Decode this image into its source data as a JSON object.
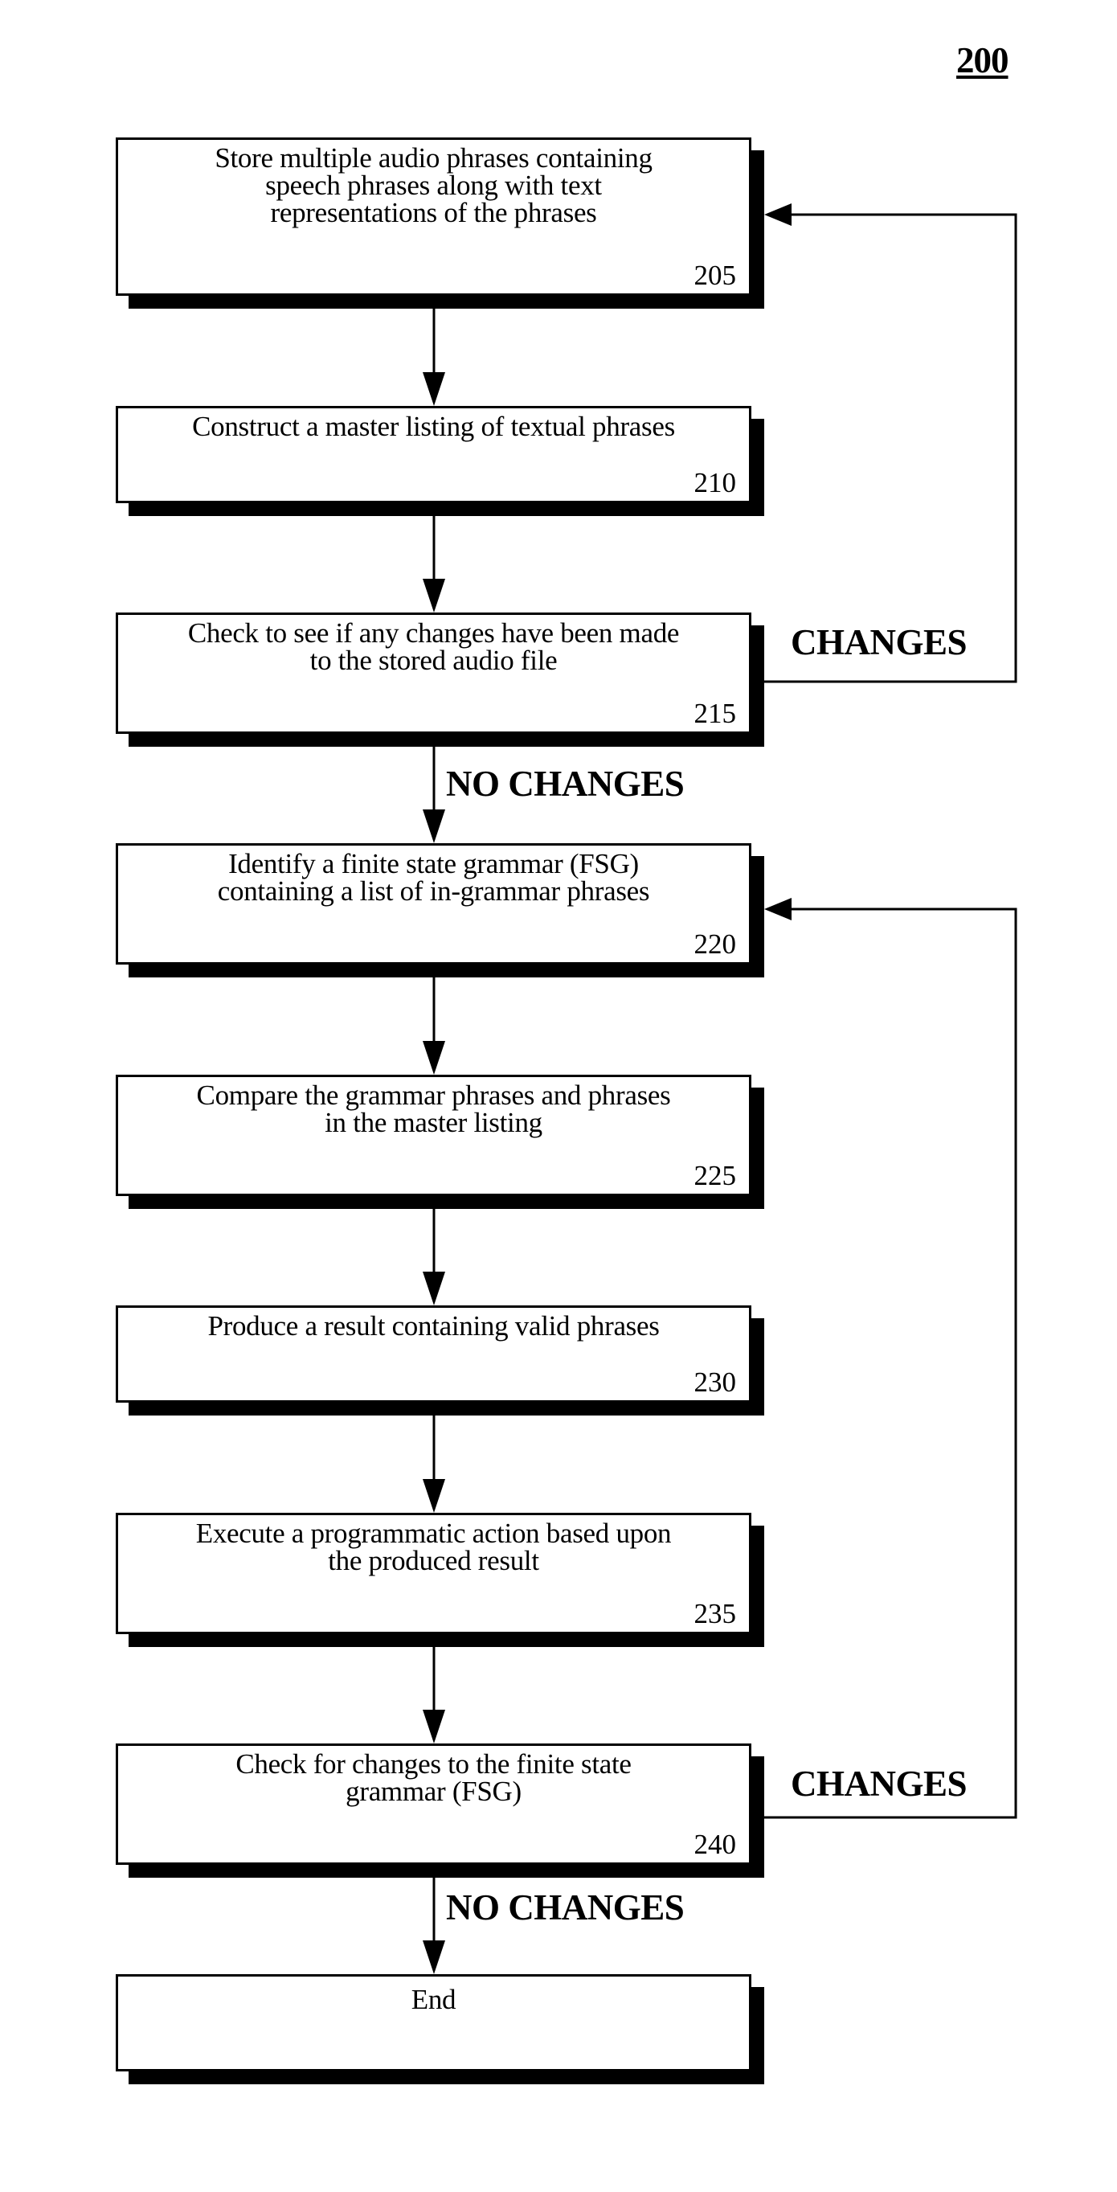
{
  "figure": {
    "number": "200"
  },
  "steps": [
    {
      "id": "205",
      "text": "Store multiple audio phrases containing speech phrases along with text representations of the phrases",
      "lines": [
        "Store multiple audio phrases containing",
        "speech phrases along with text",
        "representations of the phrases"
      ]
    },
    {
      "id": "210",
      "text": "Construct a master listing of textual phrases",
      "lines": [
        "Construct a master listing of textual phrases"
      ]
    },
    {
      "id": "215",
      "text": "Check to see if any changes have been made to the stored audio file",
      "lines": [
        "Check to see if any changes have been made",
        "to the stored audio file"
      ]
    },
    {
      "id": "220",
      "text": "Identify a finite state grammar (FSG) containing a list of in-grammar phrases",
      "lines": [
        "Identify a finite state grammar (FSG)",
        "containing a list of in-grammar phrases"
      ]
    },
    {
      "id": "225",
      "text": "Compare the grammar phrases and phrases in the master listing",
      "lines": [
        "Compare the grammar phrases and phrases",
        "in the master listing"
      ]
    },
    {
      "id": "230",
      "text": "Produce a result containing valid phrases",
      "lines": [
        "Produce a result containing valid phrases"
      ]
    },
    {
      "id": "235",
      "text": "Execute a programmatic action based upon the produced result",
      "lines": [
        "Execute a programmatic action based upon",
        "the produced result"
      ]
    },
    {
      "id": "240",
      "text": "Check for changes to the finite state grammar (FSG)",
      "lines": [
        "Check for changes to the finite state",
        "grammar (FSG)"
      ]
    },
    {
      "id": "",
      "text": "End",
      "lines": [
        "End"
      ]
    }
  ],
  "edges": [
    {
      "from": "205",
      "to": "210",
      "label": ""
    },
    {
      "from": "210",
      "to": "215",
      "label": ""
    },
    {
      "from": "215",
      "to": "205",
      "label": "CHANGES"
    },
    {
      "from": "215",
      "to": "220",
      "label": "NO CHANGES"
    },
    {
      "from": "220",
      "to": "225",
      "label": ""
    },
    {
      "from": "225",
      "to": "230",
      "label": ""
    },
    {
      "from": "230",
      "to": "235",
      "label": ""
    },
    {
      "from": "235",
      "to": "240",
      "label": ""
    },
    {
      "from": "240",
      "to": "220",
      "label": "CHANGES"
    },
    {
      "from": "240",
      "to": "End",
      "label": "NO CHANGES"
    }
  ],
  "labels": {
    "changes_1": "CHANGES",
    "no_changes_1": "NO CHANGES",
    "changes_2": "CHANGES",
    "no_changes_2": "NO CHANGES"
  }
}
